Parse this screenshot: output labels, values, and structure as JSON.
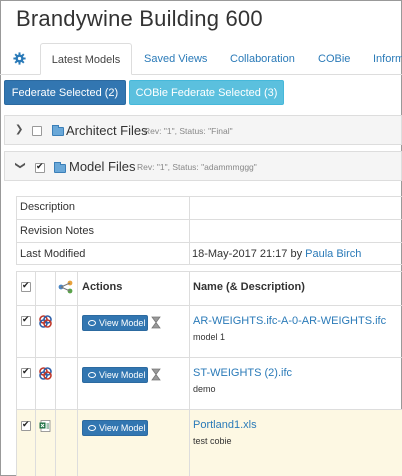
{
  "page": {
    "title": "Brandywine Building 600"
  },
  "tabs": [
    {
      "label": "Latest Models",
      "active": true
    },
    {
      "label": "Saved Views"
    },
    {
      "label": "Collaboration"
    },
    {
      "label": "COBie"
    },
    {
      "label": "Inform"
    }
  ],
  "buttons": {
    "federate": "Federate Selected (2)",
    "cobie_federate": "COBie Federate Selected (3)"
  },
  "folders": [
    {
      "name": "Architect Files",
      "meta": "Rev: \"1\",  Status: \"Final\"",
      "expanded": false,
      "checked": false
    },
    {
      "name": "Model Files",
      "meta": "Rev: \"1\",  Status: \"adammmggg\"",
      "expanded": true,
      "checked": true
    }
  ],
  "details": {
    "description_label": "Description",
    "description_value": "",
    "revision_notes_label": "Revision Notes",
    "revision_notes_value": "",
    "last_modified_label": "Last Modified",
    "last_modified_value": "18-May-2017 21:17 by ",
    "last_modified_user": "Paula Birch"
  },
  "table": {
    "headers": {
      "actions": "Actions",
      "name": "Name (& Description)"
    },
    "view_label": "View Model",
    "rows": [
      {
        "file": "AR-WEIGHTS.ifc-A-0-AR-WEIGHTS.ifc",
        "desc": "model 1",
        "type": "ifc",
        "checked": true
      },
      {
        "file": "ST-WEIGHTS (2).ifc",
        "desc": "demo",
        "type": "ifc",
        "checked": true
      },
      {
        "file": "Portland1.xls",
        "desc": "test cobie",
        "type": "xls",
        "checked": true
      }
    ]
  },
  "colors": {
    "primary": "#3276b1",
    "info": "#5bc0de",
    "link": "#2a7ab8",
    "highlight_row": "#fdf8e3"
  },
  "icons": {
    "settings": "gear-icon",
    "folder": "folder-icon",
    "hourglass": "hourglass-icon",
    "share": "share-icon",
    "eye": "eye-icon"
  }
}
